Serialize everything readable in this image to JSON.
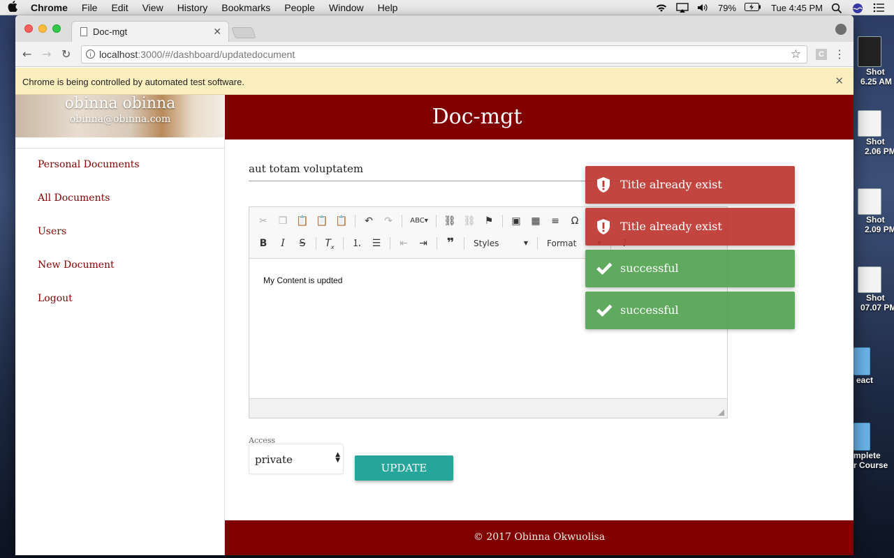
{
  "os": {
    "menu_items": [
      "Chrome",
      "File",
      "Edit",
      "View",
      "History",
      "Bookmarks",
      "People",
      "Window",
      "Help"
    ],
    "battery": "79%",
    "clock": "Tue 4:45 PM"
  },
  "desktop": {
    "items": [
      {
        "label": "Shot",
        "sub": "6.25 AM"
      },
      {
        "label": "Shot",
        "sub": "2.06 PM"
      },
      {
        "label": "Shot",
        "sub": "2.09 PM"
      },
      {
        "label": "Shot",
        "sub": "07.07 PM"
      },
      {
        "label": "eact",
        "sub": ""
      },
      {
        "label": "mplete",
        "sub": "r Course"
      }
    ]
  },
  "browser": {
    "tab_title": "Doc-mgt",
    "url_host": "localhost",
    "url_path": ":3000/#/dashboard/updatedocument",
    "ext_letter": "C",
    "infobar_text": "Chrome is being controlled by automated test software."
  },
  "sidebar": {
    "user_name": "obinna obinna",
    "user_email": "obinna@obinna.com",
    "links": [
      "Personal Documents",
      "All Documents",
      "Users",
      "New Document",
      "Logout"
    ]
  },
  "header": {
    "brand": "Doc-mgt"
  },
  "form": {
    "title_value": "aut totam voluptatem",
    "editor_content": "My Content is updted",
    "styles_label": "Styles",
    "format_label": "Format",
    "access_label": "Access",
    "access_value": "private",
    "update_label": "UPDATE"
  },
  "toasts": [
    {
      "type": "error",
      "message": "Title already exist"
    },
    {
      "type": "error",
      "message": "Title already exist"
    },
    {
      "type": "success",
      "message": "successful"
    },
    {
      "type": "success",
      "message": "successful"
    }
  ],
  "footer": {
    "copyright": "© 2017 Obinna Okwuolisa"
  },
  "colors": {
    "brand": "#800000",
    "accent": "#26a69a",
    "error": "#bd362f",
    "success": "#51a351"
  }
}
